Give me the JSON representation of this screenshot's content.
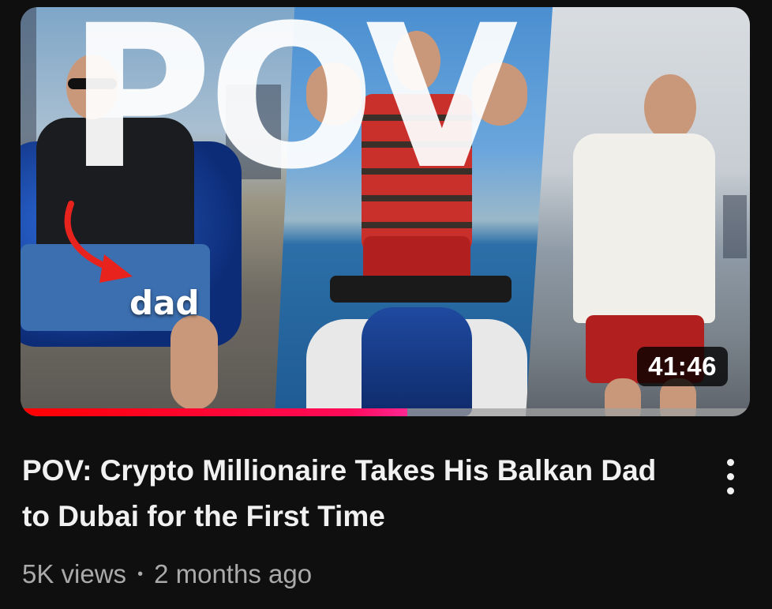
{
  "thumbnail": {
    "overlay_text": "dad",
    "big_text": "POV",
    "duration": "41:46",
    "watch_progress": 0.53
  },
  "video": {
    "title": "POV: Crypto Millionaire Takes His Balkan Dad to Dubai for the First Time",
    "views": "5K views",
    "separator": "•",
    "age": "2 months ago"
  },
  "icons": {
    "menu": "more-vert-icon",
    "arrow": "red-arrow-icon"
  },
  "colors": {
    "background": "#0f0f0f",
    "progress": "#ff0033",
    "meta_text": "#aaaaaa",
    "title_text": "#f1f1f1"
  }
}
